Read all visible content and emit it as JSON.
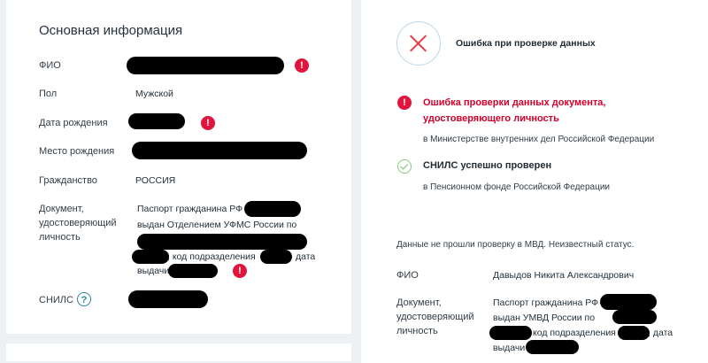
{
  "left": {
    "title": "Основная информация",
    "rows": {
      "fio_label": "ФИО",
      "gender_label": "Пол",
      "gender_value": "Мужской",
      "dob_label": "Дата рождения",
      "pob_label": "Место рождения",
      "citizenship_label": "Гражданство",
      "citizenship_value": "РОССИЯ",
      "doc_label_1": "Документ,",
      "doc_label_2": "удостоверяющий",
      "doc_label_3": "личность",
      "doc_line1": "Паспорт гражданина РФ",
      "doc_line2": "выдан Отделением УФМС России по",
      "doc_line3_a": ", код подразделения",
      "doc_line3_b": "дата",
      "doc_line4": "выдачи",
      "snils_label": "СНИЛС"
    },
    "help_glyph": "?",
    "error_glyph": "!"
  },
  "right": {
    "status_title": "Ошибка при проверке данных",
    "error_title_1": "Ошибка проверки данных документа,",
    "error_title_2": "удостоверяющего личность",
    "error_source": "в Министерстве внутренних дел Российской Федерации",
    "ok_title": "СНИЛС успешно проверен",
    "ok_source": "в Пенсионном фонде Российской Федерации",
    "note": "Данные не прошли проверку в МВД. Неизвестный статус.",
    "fio_label": "ФИО",
    "fio_value": "Давыдов Никита Александрович",
    "doc_label_1": "Документ,",
    "doc_label_2": "удостоверяющий",
    "doc_label_3": "личность",
    "doc_line1": "Паспорт гражданина РФ",
    "doc_line2": "выдан УМВД России по",
    "doc_line3_a": "код подразделения",
    "doc_line3_b": ", дата",
    "doc_line4": "выдачи"
  },
  "colors": {
    "error_red": "#e0143c",
    "ok_green": "#86c87a",
    "link_blue": "#2b86a8"
  },
  "icons": [
    "error-icon",
    "close-icon",
    "check-icon",
    "help-icon"
  ]
}
